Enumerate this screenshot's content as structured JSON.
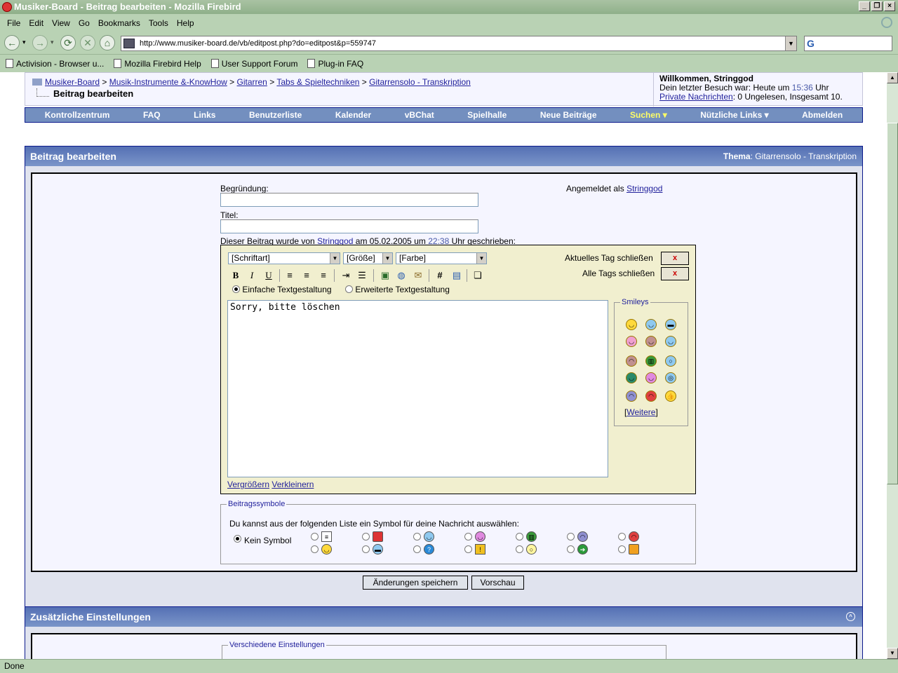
{
  "window": {
    "title": "Musiker-Board - Beitrag bearbeiten - Mozilla Firebird"
  },
  "menu": [
    "File",
    "Edit",
    "View",
    "Go",
    "Bookmarks",
    "Tools",
    "Help"
  ],
  "url": "http://www.musiker-board.de/vb/editpost.php?do=editpost&p=559747",
  "bookmarks": [
    "Activision - Browser u...",
    "Mozilla Firebird Help",
    "User Support Forum",
    "Plug-in FAQ"
  ],
  "status": "Done",
  "breadcrumb": {
    "items": [
      "Musiker-Board",
      "Musik-Instrumente &-KnowHow",
      "Gitarren",
      "Tabs & Spieltechniken",
      "Gitarrensolo - Transkription"
    ],
    "separator": ">",
    "current": "Beitrag bearbeiten"
  },
  "welcome": {
    "title": "Willkommen, Stringgod",
    "last_visit_prefix": "Dein letzter Besuch war: Heute um",
    "last_visit_time": "15:36",
    "last_visit_suffix": "Uhr",
    "pm_link": "Private Nachrichten",
    "pm_info": ": 0 Ungelesen, Insgesamt 10."
  },
  "nav": [
    "Kontrollzentrum",
    "FAQ",
    "Links",
    "Benutzerliste",
    "Kalender",
    "vBChat",
    "Spielhalle",
    "Neue Beiträge",
    "Suchen ▾",
    "Nützliche Links ▾",
    "Abmelden"
  ],
  "panel": {
    "title": "Beitrag bearbeiten",
    "thema_label": "Thema",
    "thema_value": ": Gitarrensolo - Transkription"
  },
  "form": {
    "reason_label": "Begründung:",
    "reason_value": "",
    "title_label": "Titel:",
    "title_value": "",
    "logged_in_as": "Angemeldet als",
    "username": "Stringgod",
    "written_prefix": "Dieser Beitrag wurde von",
    "written_user": "Stringgod",
    "written_mid": "am 05.02.2005 um",
    "written_time": "22:38",
    "written_suffix": "Uhr geschrieben:"
  },
  "editor": {
    "font_select": "[Schriftart]",
    "size_select": "[Größe]",
    "color_select": "[Farbe]",
    "close_current": "Aktuelles Tag schließen",
    "close_all": "Alle Tags schließen",
    "close_btn": "x",
    "mode_simple": "Einfache Textgestaltung",
    "mode_advanced": "Erweiterte Textgestaltung",
    "text": "Sorry, bitte löschen",
    "enlarge": "Vergrößern",
    "shrink": "Verkleinern",
    "smileys_legend": "Smileys",
    "more_smileys": "Weitere",
    "more_open": "[",
    "more_close": "]"
  },
  "symbols": {
    "legend": "Beitragssymbole",
    "intro": "Du kannst aus der folgenden Liste ein Symbol für deine Nachricht auswählen:",
    "none_label": "Kein Symbol"
  },
  "buttons": {
    "save": "Änderungen speichern",
    "preview": "Vorschau"
  },
  "panel2": {
    "title": "Zusätzliche Einstellungen",
    "misc_legend": "Verschiedene Einstellungen"
  }
}
